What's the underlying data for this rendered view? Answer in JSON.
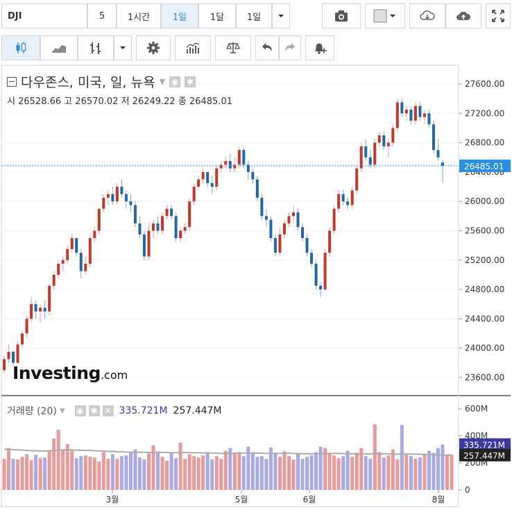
{
  "toolbar": {
    "symbol": "DJI",
    "intervals": [
      {
        "label": "5",
        "active": false
      },
      {
        "label": "1시간",
        "active": false
      },
      {
        "label": "1일",
        "active": true
      },
      {
        "label": "1달",
        "active": false
      },
      {
        "label": "1일",
        "active": false
      }
    ]
  },
  "legend": {
    "title": "다우존스, 미국, 일, 뉴욕",
    "open_label": "시",
    "open": "26528.66",
    "high_label": "고",
    "high": "26570.02",
    "low_label": "저",
    "low": "26249.22",
    "close_label": "종",
    "close": "26485.01"
  },
  "volume_legend": {
    "title": "거래량 (20)",
    "value1": "335.721M",
    "value2": "257.447M"
  },
  "brand": {
    "word": "Investing",
    "suffix": ".com"
  },
  "colors": {
    "up": "#c0392b",
    "up_fill": "#e89b9b",
    "down": "#2266aa",
    "down_fill": "#a9a9e6",
    "ma": "#aaaaaa",
    "price_tag": "#2a8fe0",
    "vol_tag1": "#3a3aa0",
    "vol_tag2": "#222222"
  },
  "chart_data": {
    "type": "candlestick",
    "price_axis": {
      "ticks": [
        "27600.00",
        "27200.00",
        "26800.00",
        "26400.00",
        "26000.00",
        "25600.00",
        "25200.00",
        "24800.00",
        "24400.00",
        "24000.00",
        "23600.00"
      ],
      "range": [
        23350,
        27800
      ]
    },
    "last_price_label": "26485.01",
    "last_price": 26485.01,
    "x_axis": {
      "ticks": [
        "3월",
        "5월",
        "6월",
        "8월"
      ]
    },
    "volume_axis": {
      "ticks": [
        "600M",
        "400M",
        "200M",
        "0"
      ],
      "range": [
        0,
        650
      ]
    },
    "volume_last_labels": [
      "335.721M",
      "257.447M"
    ],
    "candles": [
      [
        23700,
        23900,
        23650,
        23850
      ],
      [
        23850,
        24050,
        23800,
        23950
      ],
      [
        23950,
        23970,
        23750,
        23800
      ],
      [
        23800,
        24100,
        23780,
        24050
      ],
      [
        24050,
        24250,
        24000,
        24200
      ],
      [
        24200,
        24450,
        24150,
        24400
      ],
      [
        24400,
        24700,
        24350,
        24600
      ],
      [
        24600,
        24650,
        24400,
        24500
      ],
      [
        24500,
        24600,
        24350,
        24550
      ],
      [
        24550,
        24650,
        24400,
        24500
      ],
      [
        24500,
        24880,
        24450,
        24850
      ],
      [
        24850,
        25050,
        24800,
        25000
      ],
      [
        25000,
        25200,
        24950,
        25150
      ],
      [
        25150,
        25250,
        25050,
        25200
      ],
      [
        25200,
        25400,
        25150,
        25350
      ],
      [
        25350,
        25550,
        25300,
        25500
      ],
      [
        25500,
        25500,
        25250,
        25300
      ],
      [
        25300,
        25350,
        24950,
        25050
      ],
      [
        25050,
        25250,
        25000,
        25150
      ],
      [
        25150,
        25550,
        25100,
        25500
      ],
      [
        25500,
        25650,
        25450,
        25600
      ],
      [
        25600,
        25900,
        25550,
        25900
      ],
      [
        25900,
        26100,
        25850,
        26050
      ],
      [
        26050,
        26150,
        25950,
        26100
      ],
      [
        26100,
        26200,
        25950,
        26000
      ],
      [
        26000,
        26250,
        25950,
        26200
      ],
      [
        26200,
        26300,
        26050,
        26100
      ],
      [
        26100,
        26150,
        25900,
        26000
      ],
      [
        26000,
        26100,
        25850,
        25950
      ],
      [
        25950,
        26000,
        25650,
        25700
      ],
      [
        25700,
        25800,
        25500,
        25550
      ],
      [
        25550,
        25600,
        25200,
        25250
      ],
      [
        25250,
        25700,
        25200,
        25600
      ],
      [
        25600,
        25750,
        25500,
        25700
      ],
      [
        25700,
        25800,
        25550,
        25600
      ],
      [
        25600,
        25850,
        25550,
        25800
      ],
      [
        25800,
        25950,
        25750,
        25900
      ],
      [
        25900,
        25950,
        25750,
        25800
      ],
      [
        25800,
        25850,
        25450,
        25500
      ],
      [
        25500,
        25650,
        25450,
        25600
      ],
      [
        25600,
        25700,
        25550,
        25650
      ],
      [
        25650,
        26050,
        25600,
        26000
      ],
      [
        26000,
        26250,
        25950,
        26200
      ],
      [
        26200,
        26350,
        26150,
        26300
      ],
      [
        26300,
        26450,
        26250,
        26400
      ],
      [
        26400,
        26400,
        26200,
        26250
      ],
      [
        26250,
        26350,
        26100,
        26200
      ],
      [
        26200,
        26500,
        26150,
        26450
      ],
      [
        26450,
        26550,
        26380,
        26500
      ],
      [
        26500,
        26600,
        26450,
        26550
      ],
      [
        26550,
        26650,
        26400,
        26450
      ],
      [
        26450,
        26600,
        26400,
        26500
      ],
      [
        26500,
        26750,
        26450,
        26700
      ],
      [
        26700,
        26750,
        26450,
        26500
      ],
      [
        26500,
        26550,
        26300,
        26400
      ],
      [
        26400,
        26450,
        26250,
        26300
      ],
      [
        26300,
        26350,
        26000,
        26050
      ],
      [
        26050,
        26100,
        25750,
        25800
      ],
      [
        25800,
        25900,
        25650,
        25750
      ],
      [
        25750,
        25800,
        25450,
        25500
      ],
      [
        25500,
        25550,
        25250,
        25300
      ],
      [
        25300,
        25650,
        25250,
        25550
      ],
      [
        25550,
        25750,
        25500,
        25700
      ],
      [
        25700,
        25850,
        25650,
        25800
      ],
      [
        25800,
        25950,
        25700,
        25850
      ],
      [
        25850,
        25900,
        25600,
        25650
      ],
      [
        25650,
        25700,
        25450,
        25500
      ],
      [
        25500,
        25550,
        25250,
        25300
      ],
      [
        25300,
        25350,
        25100,
        25150
      ],
      [
        25150,
        25200,
        24800,
        24850
      ],
      [
        24850,
        24900,
        24700,
        24800
      ],
      [
        24800,
        25350,
        24780,
        25300
      ],
      [
        25300,
        25650,
        25250,
        25600
      ],
      [
        25600,
        25950,
        25550,
        25900
      ],
      [
        25900,
        26150,
        25850,
        26100
      ],
      [
        26100,
        26150,
        25950,
        26000
      ],
      [
        26000,
        26050,
        25900,
        25950
      ],
      [
        25950,
        26200,
        25900,
        26150
      ],
      [
        26150,
        26500,
        26100,
        26450
      ],
      [
        26450,
        26800,
        26400,
        26750
      ],
      [
        26750,
        26850,
        26550,
        26600
      ],
      [
        26600,
        26700,
        26450,
        26500
      ],
      [
        26500,
        26850,
        26450,
        26800
      ],
      [
        26800,
        26950,
        26750,
        26900
      ],
      [
        26900,
        26950,
        26700,
        26750
      ],
      [
        26750,
        26850,
        26600,
        26800
      ],
      [
        26800,
        27050,
        26750,
        27000
      ],
      [
        27000,
        27400,
        26950,
        27350
      ],
      [
        27350,
        27400,
        27150,
        27200
      ],
      [
        27200,
        27300,
        27100,
        27250
      ],
      [
        27250,
        27300,
        27050,
        27100
      ],
      [
        27100,
        27350,
        27050,
        27300
      ],
      [
        27300,
        27350,
        27100,
        27150
      ],
      [
        27150,
        27250,
        27050,
        27200
      ],
      [
        27200,
        27250,
        27000,
        27050
      ],
      [
        27050,
        27100,
        26650,
        26700
      ],
      [
        26700,
        26850,
        26550,
        26600
      ],
      [
        26528.66,
        26570.02,
        26249.22,
        26485.01
      ]
    ],
    "volumes": [
      230,
      310,
      230,
      225,
      245,
      265,
      220,
      260,
      235,
      240,
      295,
      380,
      445,
      300,
      340,
      290,
      235,
      250,
      255,
      245,
      240,
      210,
      280,
      230,
      265,
      230,
      250,
      255,
      280,
      300,
      240,
      225,
      270,
      330,
      285,
      245,
      215,
      270,
      235,
      350,
      230,
      265,
      250,
      240,
      255,
      280,
      225,
      250,
      230,
      290,
      310,
      270,
      280,
      250,
      320,
      275,
      245,
      250,
      230,
      315,
      265,
      245,
      285,
      250,
      225,
      270,
      230,
      245,
      255,
      280,
      320,
      310,
      265,
      255,
      235,
      250,
      290,
      245,
      275,
      310,
      250,
      230,
      485,
      280,
      240,
      255,
      300,
      225,
      480,
      270,
      250,
      230,
      240,
      265,
      290,
      275,
      310,
      335.721,
      257.447,
      260
    ],
    "ma20": [
      300,
      302,
      298,
      296,
      294,
      292,
      290,
      290,
      288,
      288,
      290,
      292,
      295,
      296,
      296,
      296,
      294,
      293,
      292,
      292,
      290,
      288,
      287,
      285,
      284,
      283,
      282,
      280,
      279,
      279,
      279,
      278,
      277,
      277,
      277,
      277,
      276,
      275,
      275,
      276,
      276,
      276,
      275,
      275,
      274,
      273,
      272,
      271,
      270,
      270,
      270,
      271,
      272,
      272,
      273,
      273,
      272,
      271,
      270,
      270,
      270,
      270,
      271,
      271,
      270,
      269,
      268,
      267,
      267,
      267,
      268,
      269,
      270,
      270,
      270,
      269,
      268,
      267,
      266,
      266,
      266,
      267,
      268,
      268,
      267,
      266,
      265,
      265,
      266,
      266,
      266,
      265,
      264,
      263,
      262,
      260,
      258,
      257.447,
      258,
      259
    ]
  }
}
